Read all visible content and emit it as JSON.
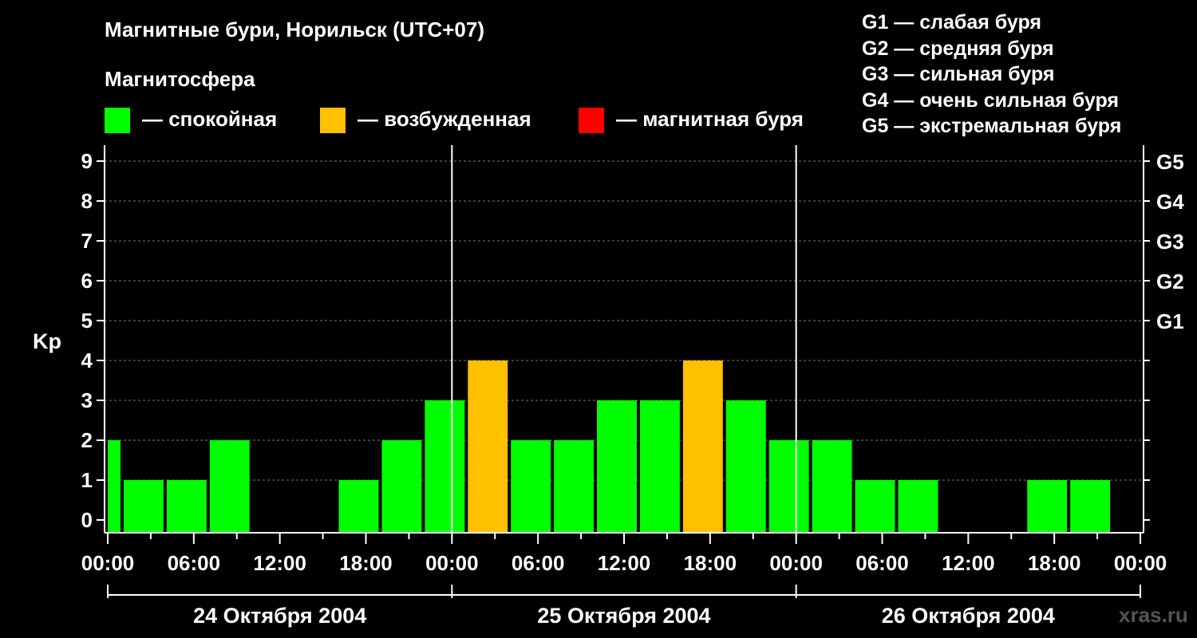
{
  "header": {
    "title": "Магнитные бури, Норильск (UTC+07)",
    "magnetosphere_label": "Магнитосфера"
  },
  "legend": {
    "states": [
      {
        "label": "— спокойная",
        "color": "#00ff00"
      },
      {
        "label": "— возбужденная",
        "color": "#ffc000"
      },
      {
        "label": "— магнитная буря",
        "color": "#ff0000"
      }
    ],
    "g_levels": [
      "G1 — слабая буря",
      "G2 — средняя буря",
      "G3 — сильная буря",
      "G4 — очень сильная буря",
      "G5 — экстремальная буря"
    ]
  },
  "watermark": "xras.ru",
  "chart_data": {
    "type": "bar",
    "ylabel": "Kp",
    "ylim": [
      0,
      9
    ],
    "yticks": [
      "0",
      "1",
      "2",
      "3",
      "4",
      "5",
      "6",
      "7",
      "8",
      "9"
    ],
    "right_axis": [
      {
        "label": "G1",
        "kp": 5
      },
      {
        "label": "G2",
        "kp": 6
      },
      {
        "label": "G3",
        "kp": 7
      },
      {
        "label": "G4",
        "kp": 8
      },
      {
        "label": "G5",
        "kp": 9
      }
    ],
    "x_tick_labels": [
      "00:00",
      "06:00",
      "12:00",
      "18:00",
      "00:00",
      "06:00",
      "12:00",
      "18:00",
      "00:00",
      "06:00",
      "12:00",
      "18:00",
      "00:00"
    ],
    "days": [
      "24 Октября 2004",
      "25 Октября 2004",
      "26 Октября 2004"
    ],
    "hours_span": 72,
    "bars": [
      {
        "start": 0,
        "end": 1,
        "value": 2,
        "color": "#00ff00"
      },
      {
        "start": 1,
        "end": 4,
        "value": 1,
        "color": "#00ff00"
      },
      {
        "start": 4,
        "end": 7,
        "value": 1,
        "color": "#00ff00"
      },
      {
        "start": 7,
        "end": 10,
        "value": 2,
        "color": "#00ff00"
      },
      {
        "start": 10,
        "end": 13,
        "value": 0,
        "color": "#00ff00"
      },
      {
        "start": 13,
        "end": 16,
        "value": 0,
        "color": "#00ff00"
      },
      {
        "start": 16,
        "end": 19,
        "value": 1,
        "color": "#00ff00"
      },
      {
        "start": 19,
        "end": 22,
        "value": 2,
        "color": "#00ff00"
      },
      {
        "start": 22,
        "end": 25,
        "value": 3,
        "color": "#00ff00"
      },
      {
        "start": 25,
        "end": 28,
        "value": 4,
        "color": "#ffc000"
      },
      {
        "start": 28,
        "end": 31,
        "value": 2,
        "color": "#00ff00"
      },
      {
        "start": 31,
        "end": 34,
        "value": 2,
        "color": "#00ff00"
      },
      {
        "start": 34,
        "end": 37,
        "value": 3,
        "color": "#00ff00"
      },
      {
        "start": 37,
        "end": 40,
        "value": 3,
        "color": "#00ff00"
      },
      {
        "start": 40,
        "end": 43,
        "value": 4,
        "color": "#ffc000"
      },
      {
        "start": 43,
        "end": 46,
        "value": 3,
        "color": "#00ff00"
      },
      {
        "start": 46,
        "end": 49,
        "value": 2,
        "color": "#00ff00"
      },
      {
        "start": 49,
        "end": 52,
        "value": 2,
        "color": "#00ff00"
      },
      {
        "start": 52,
        "end": 55,
        "value": 1,
        "color": "#00ff00"
      },
      {
        "start": 55,
        "end": 58,
        "value": 1,
        "color": "#00ff00"
      },
      {
        "start": 58,
        "end": 61,
        "value": 0,
        "color": "#00ff00"
      },
      {
        "start": 61,
        "end": 64,
        "value": 0,
        "color": "#00ff00"
      },
      {
        "start": 64,
        "end": 67,
        "value": 1,
        "color": "#00ff00"
      },
      {
        "start": 67,
        "end": 70,
        "value": 1,
        "color": "#00ff00"
      }
    ]
  }
}
